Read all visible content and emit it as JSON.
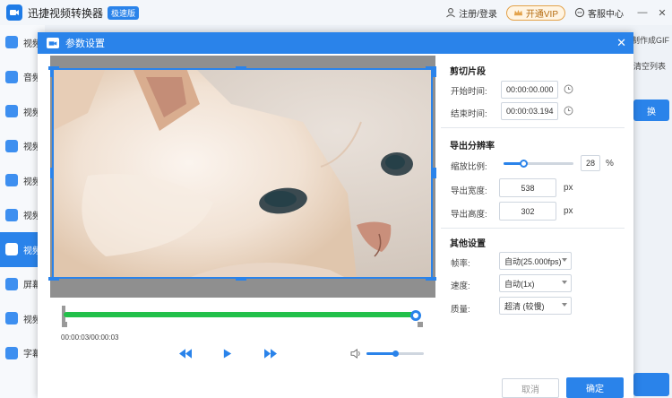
{
  "app": {
    "title": "迅捷视频转换器",
    "badge": "极速版",
    "login": "注册/登录",
    "vip": "开通VIP",
    "service": "客服中心",
    "minimize": "—",
    "close": "✕"
  },
  "sidebar": {
    "items": [
      {
        "label": "视频",
        "active": false
      },
      {
        "label": "音频",
        "active": false
      },
      {
        "label": "视频",
        "active": false
      },
      {
        "label": "视频",
        "active": false
      },
      {
        "label": "视频",
        "active": false
      },
      {
        "label": "视频",
        "active": false
      },
      {
        "label": "视频",
        "active": true
      },
      {
        "label": "屏幕",
        "active": false
      },
      {
        "label": "视频",
        "active": false
      },
      {
        "label": "字幕",
        "active": false
      }
    ]
  },
  "background": {
    "gif_link": "制作成GIF",
    "clear_list": "清空列表",
    "convert_btn": "换"
  },
  "dialog": {
    "title": "参数设置",
    "close": "✕",
    "time_display": "00:00:03/00:00:03",
    "clip": {
      "title": "剪切片段",
      "start_label": "开始时间:",
      "start_value": "00:00:00.000",
      "end_label": "结束时间:",
      "end_value": "00:00:03.194"
    },
    "resolution": {
      "title": "导出分辨率",
      "scale_label": "缩放比例:",
      "scale_value": "28",
      "scale_unit": "%",
      "scale_fraction": 0.28,
      "width_label": "导出宽度:",
      "width_value": "538",
      "width_unit": "px",
      "height_label": "导出高度:",
      "height_value": "302",
      "height_unit": "px"
    },
    "other": {
      "title": "其他设置",
      "fps_label": "帧率:",
      "fps_value": "自动(25.000fps)",
      "speed_label": "速度:",
      "speed_value": "自动(1x)",
      "quality_label": "质量:",
      "quality_value": "超清 (较慢)"
    },
    "playback": {
      "progress_fraction": 1.0,
      "volume_fraction": 0.5
    },
    "cancel": "取消",
    "ok": "确定"
  },
  "colors": {
    "accent": "#2a83ea",
    "timeline": "#22c04a"
  }
}
